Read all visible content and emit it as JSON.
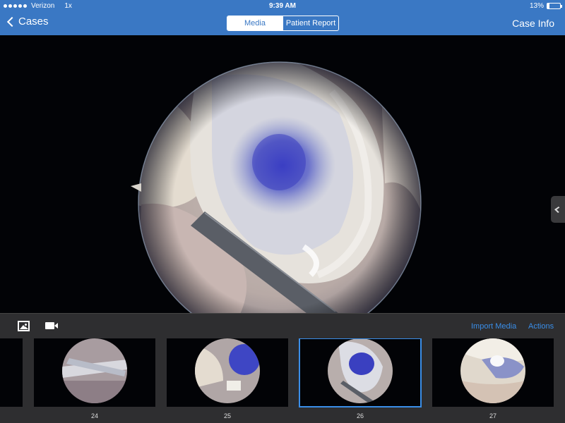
{
  "status": {
    "carrier": "Verizon",
    "extra": "1x",
    "time": "9:39 AM",
    "battery": "13%"
  },
  "nav": {
    "back_label": "Cases",
    "right_label": "Case Info"
  },
  "tabs": [
    {
      "label": "Media",
      "active": true
    },
    {
      "label": "Patient Report",
      "active": false
    }
  ],
  "toolbar": {
    "photo_icon": "photo-icon",
    "video_icon": "video-camera-icon",
    "import_label": "Import Media",
    "actions_label": "Actions"
  },
  "thumbnails": [
    {
      "number": "24",
      "selected": false
    },
    {
      "number": "25",
      "selected": false
    },
    {
      "number": "26",
      "selected": true
    },
    {
      "number": "27",
      "selected": false
    }
  ],
  "colors": {
    "nav_bg": "#3a78c4",
    "accent": "#3a8ee8",
    "toolbar_bg": "#2e2e30"
  }
}
